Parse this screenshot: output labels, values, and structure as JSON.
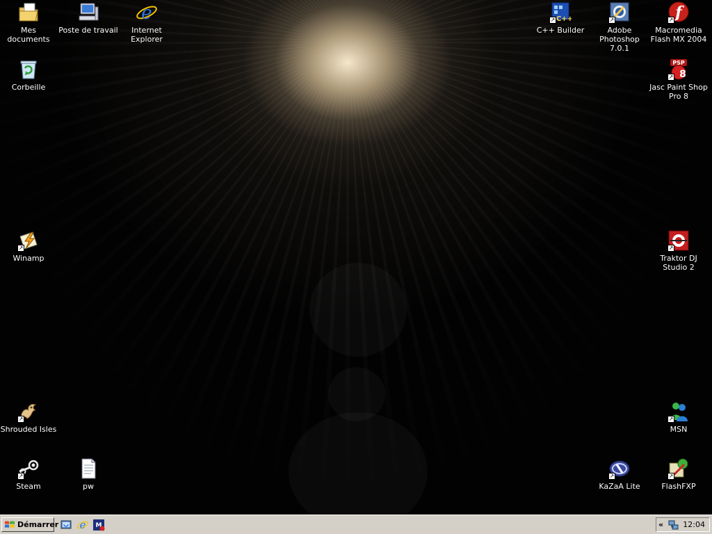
{
  "desktop": {
    "icons": [
      {
        "label": "Mes documents",
        "icon": "my-documents-icon"
      },
      {
        "label": "Poste de travail",
        "icon": "my-computer-icon"
      },
      {
        "label": "Internet Explorer",
        "icon": "internet-explorer-icon"
      },
      {
        "label": "C++ Builder",
        "icon": "cpp-builder-icon"
      },
      {
        "label": "Adobe Photoshop 7.0.1",
        "icon": "photoshop-icon"
      },
      {
        "label": "Macromedia Flash MX 2004",
        "icon": "flash-icon"
      },
      {
        "label": "Corbeille",
        "icon": "recycle-bin-icon"
      },
      {
        "label": "Jasc Paint Shop Pro 8",
        "icon": "paint-shop-pro-icon",
        "badge": "PSP"
      },
      {
        "label": "Winamp",
        "icon": "winamp-icon"
      },
      {
        "label": "Traktor DJ Studio 2",
        "icon": "traktor-icon"
      },
      {
        "label": "Shrouded Isles",
        "icon": "shrouded-isles-icon"
      },
      {
        "label": "MSN",
        "icon": "msn-icon"
      },
      {
        "label": "Steam",
        "icon": "steam-icon"
      },
      {
        "label": "pw",
        "icon": "text-file-icon"
      },
      {
        "label": "KaZaA Lite",
        "icon": "kazaa-icon"
      },
      {
        "label": "FlashFXP",
        "icon": "flashfxp-icon"
      }
    ]
  },
  "taskbar": {
    "start_label": "Démarrer",
    "quick_launch": [
      "show-desktop-icon",
      "internet-explorer-icon",
      "msn-messenger-icon"
    ],
    "tray": {
      "chevron": "«",
      "clock": "12:04"
    }
  },
  "colors": {
    "taskbar": "#d4d0c8",
    "desktop_background": "#020202",
    "label_text": "#ffffff"
  }
}
